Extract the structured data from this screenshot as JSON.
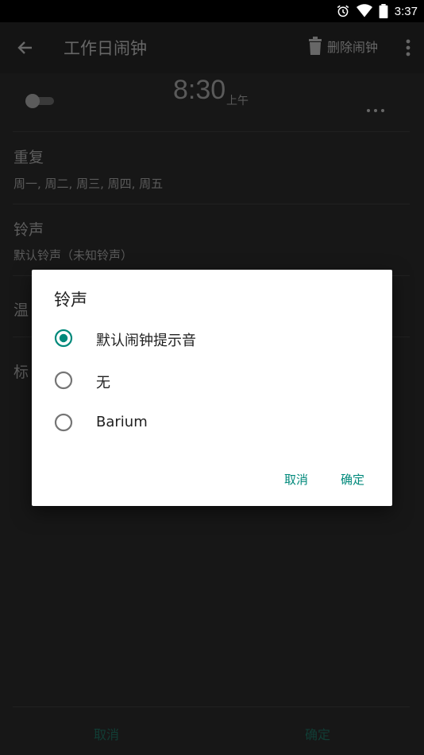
{
  "status_bar": {
    "time": "3:37"
  },
  "app_bar": {
    "title": "工作日闹钟",
    "delete_label": "删除闹钟"
  },
  "alarm": {
    "time": "8:30",
    "ampm": "上午",
    "enabled": false
  },
  "rows": [
    {
      "title": "重复",
      "subtitle": "周一, 周二, 周三, 周四, 周五"
    },
    {
      "title": "铃声",
      "subtitle": "默认铃声（未知铃声）"
    },
    {
      "title": "温",
      "subtitle": ""
    },
    {
      "title": "标",
      "subtitle": ""
    }
  ],
  "bottom": {
    "cancel": "取消",
    "confirm": "确定"
  },
  "dialog": {
    "title": "铃声",
    "options": [
      {
        "label": "默认闹钟提示音",
        "selected": true
      },
      {
        "label": "无",
        "selected": false
      },
      {
        "label": "Barium",
        "selected": false
      }
    ],
    "cancel": "取消",
    "confirm": "确定"
  },
  "colors": {
    "accent": "#00897b",
    "background": "#242424",
    "dialog_bg": "#ffffff"
  }
}
